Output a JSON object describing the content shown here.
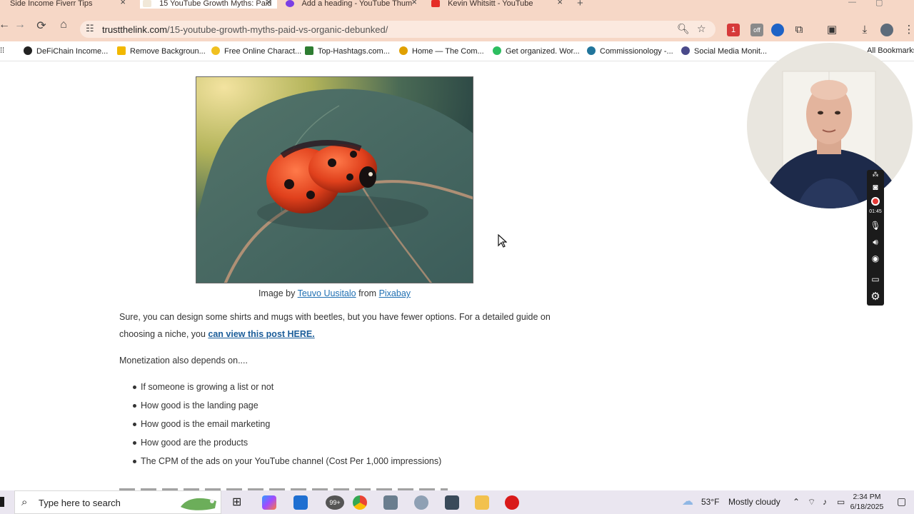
{
  "browser": {
    "tabs": [
      {
        "title": "Side Income Fiverr Tips",
        "active": false
      },
      {
        "title": "15 YouTube Growth Myths: Paid",
        "active": true
      },
      {
        "title": "Add a heading - YouTube Thum",
        "active": false
      },
      {
        "title": "Kevin Whitsitt - YouTube",
        "active": false
      }
    ],
    "new_tab": "+",
    "close_glyph": "×",
    "url_domain": "trustthelink.com",
    "url_path": "/15-youtube-growth-myths-paid-vs-organic-debunked/",
    "extension_badge": "1",
    "extension_off": "off"
  },
  "bookmarks": {
    "items": [
      {
        "label": "DeFiChain Income...",
        "color": "#222222"
      },
      {
        "label": "Remove Backgroun...",
        "color": "#f2b800"
      },
      {
        "label": "Free Online Charact...",
        "color": "#f0c020"
      },
      {
        "label": "Top-Hashtags.com...",
        "color": "#2e7d32"
      },
      {
        "label": "Home — The Com...",
        "color": "#e0a000"
      },
      {
        "label": "Get organized. Wor...",
        "color": "#2dbe60"
      },
      {
        "label": "Commissionology -...",
        "color": "#21759b"
      },
      {
        "label": "Social Media Monit...",
        "color": "#4a4a8a"
      }
    ],
    "more": "•••",
    "all_bookmarks": "All Bookmarks"
  },
  "article": {
    "caption": {
      "prefix": "Image by ",
      "author": "Teuvo Uusitalo",
      "middle": " from ",
      "source": "Pixabay"
    },
    "para1_text": "Sure, you can design some shirts and mugs with beetles, but you have fewer options. For a detailed guide on choosing a niche, you ",
    "para1_link": "can view this post HERE.",
    "para2": "Monetization also depends on....",
    "list": [
      "If someone is growing a list or not",
      "How good is the landing page",
      "How good is the email marketing",
      "How good are the products",
      "The CPM of the ads on your YouTube channel (Cost Per 1,000 impressions)"
    ]
  },
  "recorder": {
    "timer": "01:45"
  },
  "taskbar": {
    "search_placeholder": "Type here to search",
    "mail_badge": "99+",
    "weather_temp": "53°F",
    "weather_text": "Mostly cloudy",
    "time": "2:34 PM",
    "date": "6/18/2025"
  }
}
